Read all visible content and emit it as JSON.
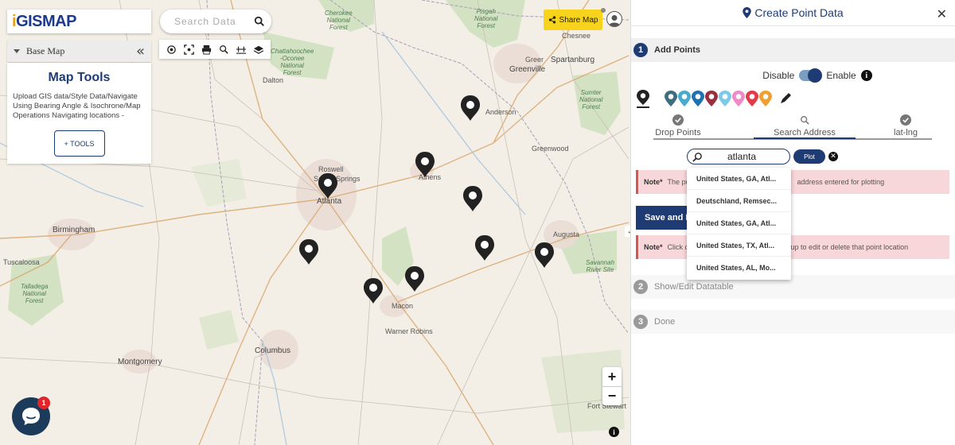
{
  "map": {
    "logo": "iGISMAP",
    "search_placeholder": "Search Data",
    "toolbar": [
      "locate-icon",
      "fullscreen-icon",
      "print-icon",
      "zoom-search-icon",
      "measure-icon",
      "layers-icon"
    ],
    "basemap_label": "Base Map",
    "basemap_collapse": "«",
    "map_tools_title": "Map Tools",
    "map_tools_desc": "Upload GIS data/Style Data/Navigate Using Bearing Angle & Isochrone/Map Operations Navigating locations -",
    "tools_button": "+ TOOLS",
    "share_label": "Share Map",
    "zoom_in": "+",
    "zoom_out": "−",
    "info": "i",
    "chat_badge": "1",
    "resize": "↔",
    "labels": {
      "cherokee": "Cherokee\nNational\nForest",
      "pisgah": "Pisgah\nNational\nForest",
      "chesnee": "Chesnee",
      "spartanburg": "Spartanburg",
      "greer": "Greer",
      "greenville": "Greenville",
      "sumter": "Sumter\nNational\nForest",
      "chattahoochee": "Chattahoochee\n-Oconee\nNational\nForest",
      "dalton": "Dalton",
      "anderson": "Anderson",
      "greenwood": "Greenwood",
      "roswell": "Roswell",
      "sandysprings": "Sandy Springs",
      "atlanta": "Atlanta",
      "athens": "Athens",
      "birmingham": "Birmingham",
      "augusta": "Augusta",
      "tuscaloosa": "Tuscaloosa",
      "talladega": "Talladega\nNational\nForest",
      "savannahriver": "Savannah\nRiver Site",
      "macon": "Macon",
      "warnerrobins": "Warner Robins",
      "columbus": "Columbus",
      "montgomery": "Montgomery",
      "fortstewart": "Fort Stewart"
    }
  },
  "panel": {
    "title": "Create Point Data",
    "close": "✕",
    "step1": {
      "num": "1",
      "label": "Add Points"
    },
    "step2": {
      "num": "2",
      "label": "Show/Edit Datatable"
    },
    "step3": {
      "num": "3",
      "label": "Done"
    },
    "toggle_off": "Disable",
    "toggle_on": "Enable",
    "toggle_info": "i",
    "marker_colors": [
      "#3e6d7d",
      "#49aad0",
      "#1f72b1",
      "#9a2f3e",
      "#7cc9ea",
      "#f08ac7",
      "#e23a4a",
      "#f0a030"
    ],
    "modes": [
      "Drop Points",
      "Search Address",
      "lat-lng"
    ],
    "address_value": "atlanta",
    "plot_label": "Plot",
    "clear_label": "✕",
    "note1_tag": "Note*",
    "note1_text": "The pu",
    "note1_text_end": "address entered for plotting",
    "save_label": "Save and P",
    "note2_tag": "Note*",
    "note2_text": "Click o",
    "note2_text_end": "opup to edit or delete that point location"
  },
  "dropdown": [
    "United States, GA, Atl...",
    "Deutschland, Remsec...",
    "United States, GA, Atl...",
    "United States, TX, Atl...",
    "United States, AL, Mo..."
  ]
}
